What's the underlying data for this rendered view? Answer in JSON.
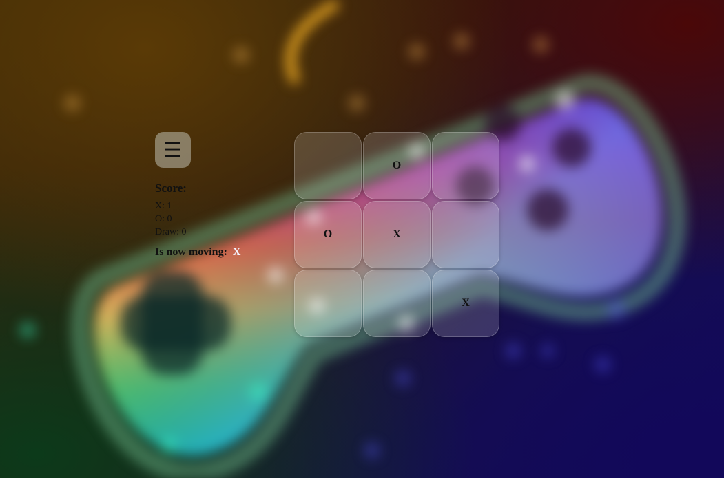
{
  "menu": {
    "icon": "hamburger-menu-icon",
    "glyph": "☰"
  },
  "score": {
    "title": "Score:",
    "x": "X: 1",
    "o": "O: 0",
    "draw": "Draw: 0"
  },
  "status": {
    "label": "Is now moving:",
    "current_player": "X"
  },
  "board": {
    "cells": [
      "",
      "O",
      "",
      "O",
      "X",
      "",
      "",
      "",
      "X"
    ]
  },
  "background": {
    "icon": "game-controller-icon"
  }
}
